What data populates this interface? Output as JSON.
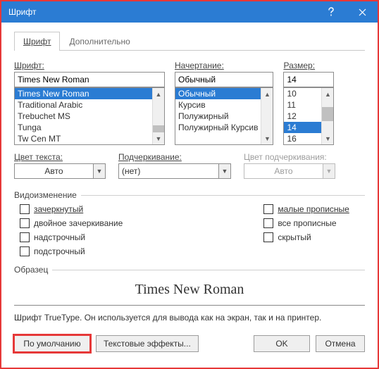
{
  "window": {
    "title": "Шрифт"
  },
  "tabs": {
    "font": "Шрифт",
    "advanced": "Дополнительно"
  },
  "labels": {
    "font": "Шрифт:",
    "style": "Начертание:",
    "size": "Размер:",
    "fontColor": "Цвет текста:",
    "underline": "Подчеркивание:",
    "underlineColor": "Цвет подчеркивания:",
    "effects": "Видоизменение",
    "sample": "Образец"
  },
  "font": {
    "value": "Times New Roman",
    "list": [
      "Times New Roman",
      "Traditional Arabic",
      "Trebuchet MS",
      "Tunga",
      "Tw Cen MT"
    ]
  },
  "style": {
    "value": "Обычный",
    "list": [
      "Обычный",
      "Курсив",
      "Полужирный",
      "Полужирный Курсив"
    ]
  },
  "size": {
    "value": "14",
    "list": [
      "10",
      "11",
      "12",
      "14",
      "16"
    ]
  },
  "fontColor": {
    "value": "Авто"
  },
  "underline": {
    "value": "(нет)"
  },
  "underlineColor": {
    "value": "Авто"
  },
  "effects": {
    "strike": "зачеркнутый",
    "dstrike": "двойное зачеркивание",
    "superscript": "надстрочный",
    "subscript": "подстрочный",
    "smallcaps": "малые прописные",
    "allcaps": "все прописные",
    "hidden": "скрытый"
  },
  "sample": {
    "text": "Times New Roman"
  },
  "hint": "Шрифт TrueType. Он используется для вывода как на экран, так и на принтер.",
  "buttons": {
    "default": "По умолчанию",
    "textEffects": "Текстовые эффекты...",
    "ok": "OK",
    "cancel": "Отмена"
  }
}
